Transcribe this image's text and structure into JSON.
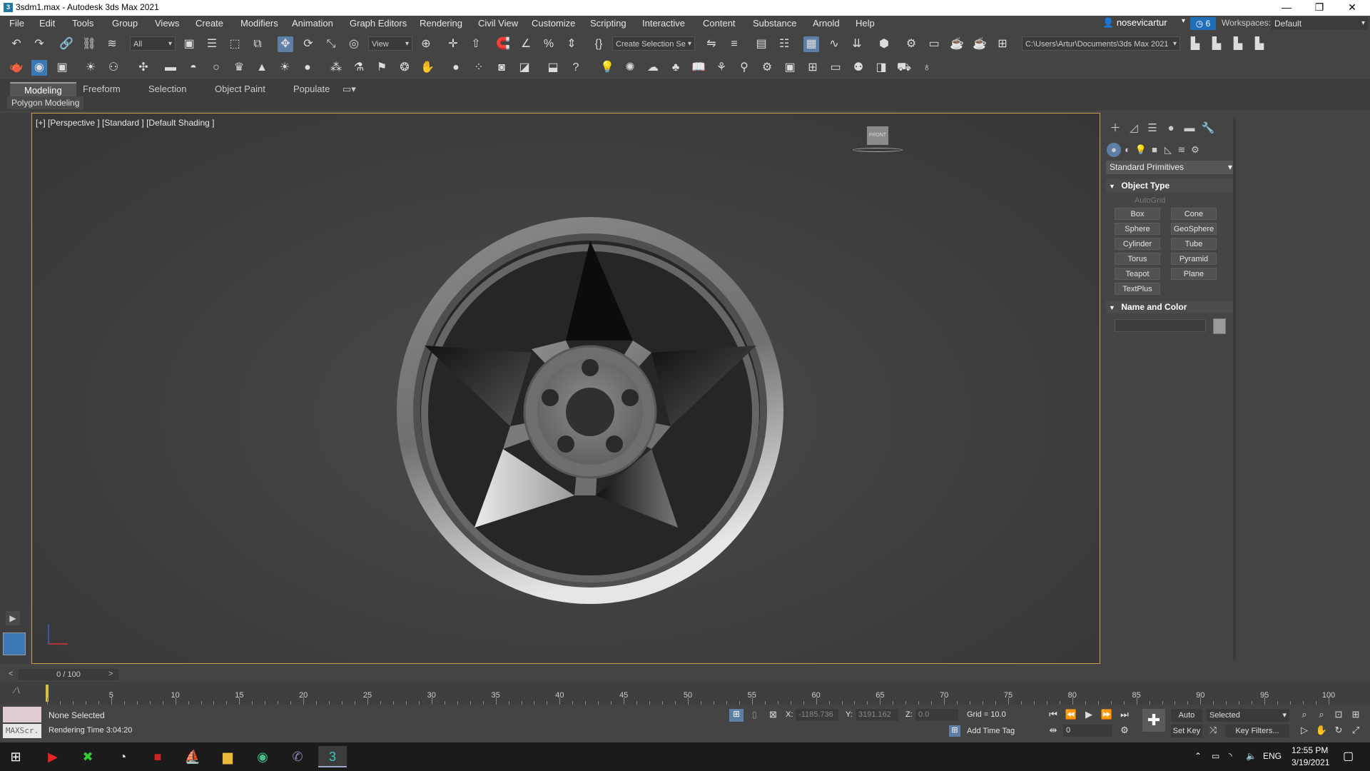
{
  "window": {
    "title": "3sdm1.max - Autodesk 3ds Max 2021",
    "controls": [
      "—",
      "❐",
      "✕"
    ]
  },
  "menubar": {
    "items": [
      "File",
      "Edit",
      "Tools",
      "Group",
      "Views",
      "Create",
      "Modifiers",
      "Animation",
      "Graph Editors",
      "Rendering",
      "Civil View",
      "Customize",
      "Scripting",
      "Interactive",
      "Content",
      "Substance",
      "Arnold",
      "Help"
    ],
    "user": "nosevicartur",
    "notification_count": "6",
    "workspaces_label": "Workspaces:",
    "workspace_value": "Default"
  },
  "toolbar": {
    "selection_filter": "All",
    "reference_coord": "View",
    "selection_set": "Create Selection Se",
    "project_path": "C:\\Users\\Artur\\Documents\\3ds Max 2021"
  },
  "ribbon": {
    "tabs": [
      "Modeling",
      "Freeform",
      "Selection",
      "Object Paint",
      "Populate"
    ],
    "active_tab": "Modeling",
    "panel_label": "Polygon Modeling"
  },
  "viewport": {
    "label": "[+] [Perspective ] [Standard ] [Default Shading ]",
    "viewcube_face": "FRONT"
  },
  "command_panel": {
    "category": "Standard Primitives",
    "object_type_title": "Object Type",
    "autogrid": "AutoGrid",
    "primitives": [
      "Box",
      "Cone",
      "Sphere",
      "GeoSphere",
      "Cylinder",
      "Tube",
      "Torus",
      "Pyramid",
      "Teapot",
      "Plane",
      "TextPlus"
    ],
    "name_color_title": "Name and Color",
    "object_color": "#9b9b9b"
  },
  "timeline": {
    "frame_display": "0 / 100",
    "ticks": [
      "5",
      "10",
      "15",
      "20",
      "25",
      "30",
      "35",
      "40",
      "45",
      "50",
      "55",
      "60",
      "65",
      "70",
      "75",
      "80",
      "85",
      "90",
      "95",
      "100"
    ]
  },
  "status": {
    "maxscript_label": "MAXScr.",
    "selection": "None Selected",
    "render_time": "Rendering Time  3:04:20",
    "x_label": "X:",
    "x_value": "-1185.736",
    "y_label": "Y:",
    "y_value": "3191.162",
    "z_label": "Z:",
    "z_value": "0.0",
    "grid": "Grid = 10.0",
    "add_time_tag": "Add Time Tag",
    "auto_key": "Auto Key",
    "set_key": "Set Key",
    "key_mode": "Selected",
    "key_filters": "Key Filters...",
    "current_frame": "0"
  },
  "taskbar": {
    "lang": "ENG",
    "time": "12:55 PM",
    "date": "3/19/2021"
  }
}
